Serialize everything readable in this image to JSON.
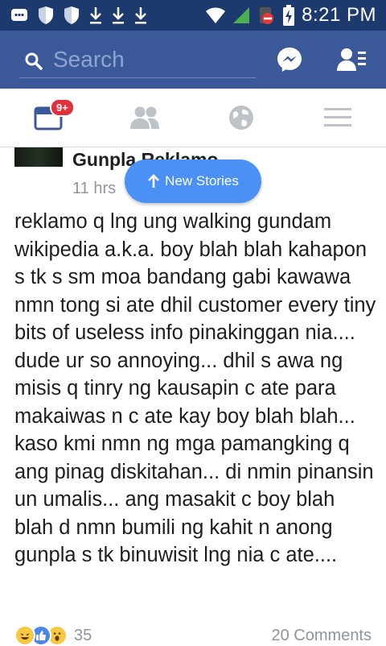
{
  "status_bar": {
    "time": "8:21 PM",
    "icons": [
      "messenger-notification-icon",
      "shield-icon",
      "shield-icon",
      "download-icon",
      "download-icon",
      "download-icon",
      "wifi-icon",
      "signal-icon",
      "battery-charging-icon"
    ]
  },
  "app_bar": {
    "search_placeholder": "Search",
    "background": "#3b5998"
  },
  "tabs": {
    "news_feed_badge": "9+",
    "accent": "#3b5998"
  },
  "post": {
    "author": "Gunpla Reklamo",
    "time": "11 hrs",
    "text": "reklamo q lng ung walking gundam wikipedia a.k.a. boy blah blah kahapon s tk s sm moa bandang gabi kawawa nmn tong si ate dhil customer every tiny bits of useless info pinakinggan nia.... dude ur so annoying... dhil s awa ng misis q tinry ng kausapin c ate para makaiwas n c ate kay boy blah blah... kaso kmi nmn ng mga pamangking q ang pinag diskitahan... di nmin pinansin un umalis... ang masakit c boy blah blah d nmn bumili ng kahit n anong gunpla s tk binuwisit lng nia c ate....",
    "reaction_count": "35",
    "comments_label": "20 Comments"
  },
  "new_stories": {
    "label": "New Stories"
  }
}
